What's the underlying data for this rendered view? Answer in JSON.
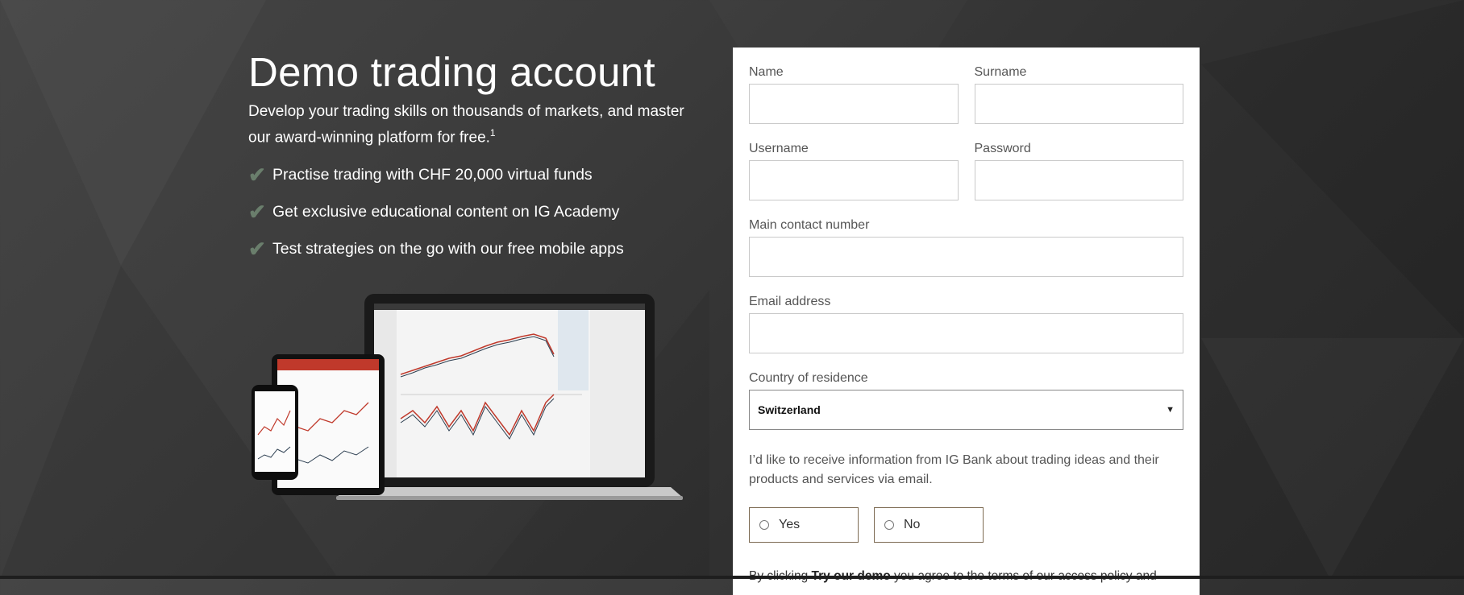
{
  "hero": {
    "title": "Demo trading account",
    "subtitle": "Develop your trading skills on thousands of markets, and master our award-winning platform for free.",
    "footnote": "1",
    "bullets": [
      "Practise trading with CHF 20,000 virtual funds",
      "Get exclusive educational content on IG Academy",
      "Test strategies on the go with our free mobile apps"
    ]
  },
  "form": {
    "name_label": "Name",
    "surname_label": "Surname",
    "username_label": "Username",
    "password_label": "Password",
    "phone_label": "Main contact number",
    "email_label": "Email address",
    "country_label": "Country of residence",
    "country_value": "Switzerland",
    "consent_text": "I’d like to receive information from IG Bank about trading ideas and their products and services via email.",
    "yes_label": "Yes",
    "no_label": "No",
    "terms_prefix": "By clicking ",
    "terms_bold": "Try our demo",
    "terms_suffix": " you agree to the terms of our access policy and"
  },
  "icons": {
    "check": "check-icon",
    "dropdown": "caret-down-icon"
  },
  "colors": {
    "check": "#6a7e6c",
    "radio_border": "#7d6b53"
  }
}
